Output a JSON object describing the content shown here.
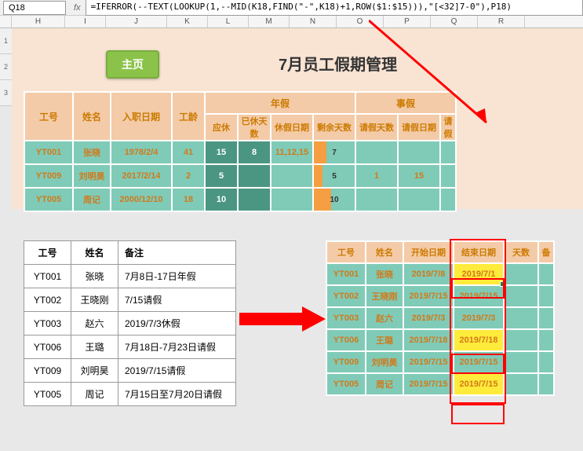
{
  "namebox": "Q18",
  "fx": "fx",
  "formula": "=IFERROR(--TEXT(LOOKUP(1,--MID(K18,FIND(\"-\",K18)+1,ROW($1:$15))),\"[<32]7-0\"),P18)",
  "cols": [
    "H",
    "I",
    "J",
    "K",
    "L",
    "M",
    "N",
    "O",
    "P",
    "Q",
    "R"
  ],
  "rows": [
    "1",
    "2",
    "3"
  ],
  "home_btn": "主页",
  "title": "7月员工假期管理",
  "hdr1": {
    "emp": "工号",
    "name": "姓名",
    "hire": "入职日期",
    "age": "工龄",
    "annual": "年假",
    "personal": "事假"
  },
  "hdr2": {
    "a": "应休",
    "b": "已休天数",
    "c": "休假日期",
    "d": "剩余天数",
    "e": "请假天数",
    "f": "请假日期",
    "g": "请假"
  },
  "t1": [
    {
      "emp": "YT001",
      "name": "张晓",
      "hire": "1978/2/4",
      "age": "41",
      "a": "15",
      "b": "8",
      "c": "11,12,15",
      "d": "7",
      "bw": 30,
      "e": "",
      "f": ""
    },
    {
      "emp": "YT009",
      "name": "刘明昊",
      "hire": "2017/2/14",
      "age": "2",
      "a": "5",
      "b": "",
      "c": "",
      "d": "5",
      "bw": 22,
      "e": "1",
      "f": "15"
    },
    {
      "emp": "YT005",
      "name": "周记",
      "hire": "2000/12/10",
      "age": "18",
      "a": "10",
      "b": "",
      "c": "",
      "d": "10",
      "bw": 42,
      "e": "",
      "f": ""
    }
  ],
  "t2h": {
    "emp": "工号",
    "name": "姓名",
    "note": "备注"
  },
  "t2": [
    {
      "emp": "YT001",
      "name": "张晓",
      "note": "7月8日-17日年假"
    },
    {
      "emp": "YT002",
      "name": "王晓刚",
      "note": "7/15请假"
    },
    {
      "emp": "YT003",
      "name": "赵六",
      "note": "2019/7/3休假"
    },
    {
      "emp": "YT006",
      "name": "王璐",
      "note": "7月18日-7月23日请假"
    },
    {
      "emp": "YT009",
      "name": "刘明昊",
      "note": "2019/7/15请假"
    },
    {
      "emp": "YT005",
      "name": "周记",
      "note": "7月15日至7月20日请假"
    }
  ],
  "t3h": {
    "emp": "工号",
    "name": "姓名",
    "start": "开始日期",
    "end": "结束日期",
    "days": "天数",
    "remark": "备"
  },
  "t3": [
    {
      "emp": "YT001",
      "name": "张晓",
      "start": "2019/7/8",
      "end": "2019/7/1",
      "hl": true
    },
    {
      "emp": "YT002",
      "name": "王晓刚",
      "start": "2019/7/15",
      "end": "2019/7/15",
      "hl": false
    },
    {
      "emp": "YT003",
      "name": "赵六",
      "start": "2019/7/3",
      "end": "2019/7/3",
      "hl": false
    },
    {
      "emp": "YT006",
      "name": "王璐",
      "start": "2019/7/18",
      "end": "2019/7/18",
      "hl": true
    },
    {
      "emp": "YT009",
      "name": "刘明昊",
      "start": "2019/7/15",
      "end": "2019/7/15",
      "hl": false
    },
    {
      "emp": "YT005",
      "name": "周记",
      "start": "2019/7/15",
      "end": "2019/7/15",
      "hl": true
    }
  ]
}
